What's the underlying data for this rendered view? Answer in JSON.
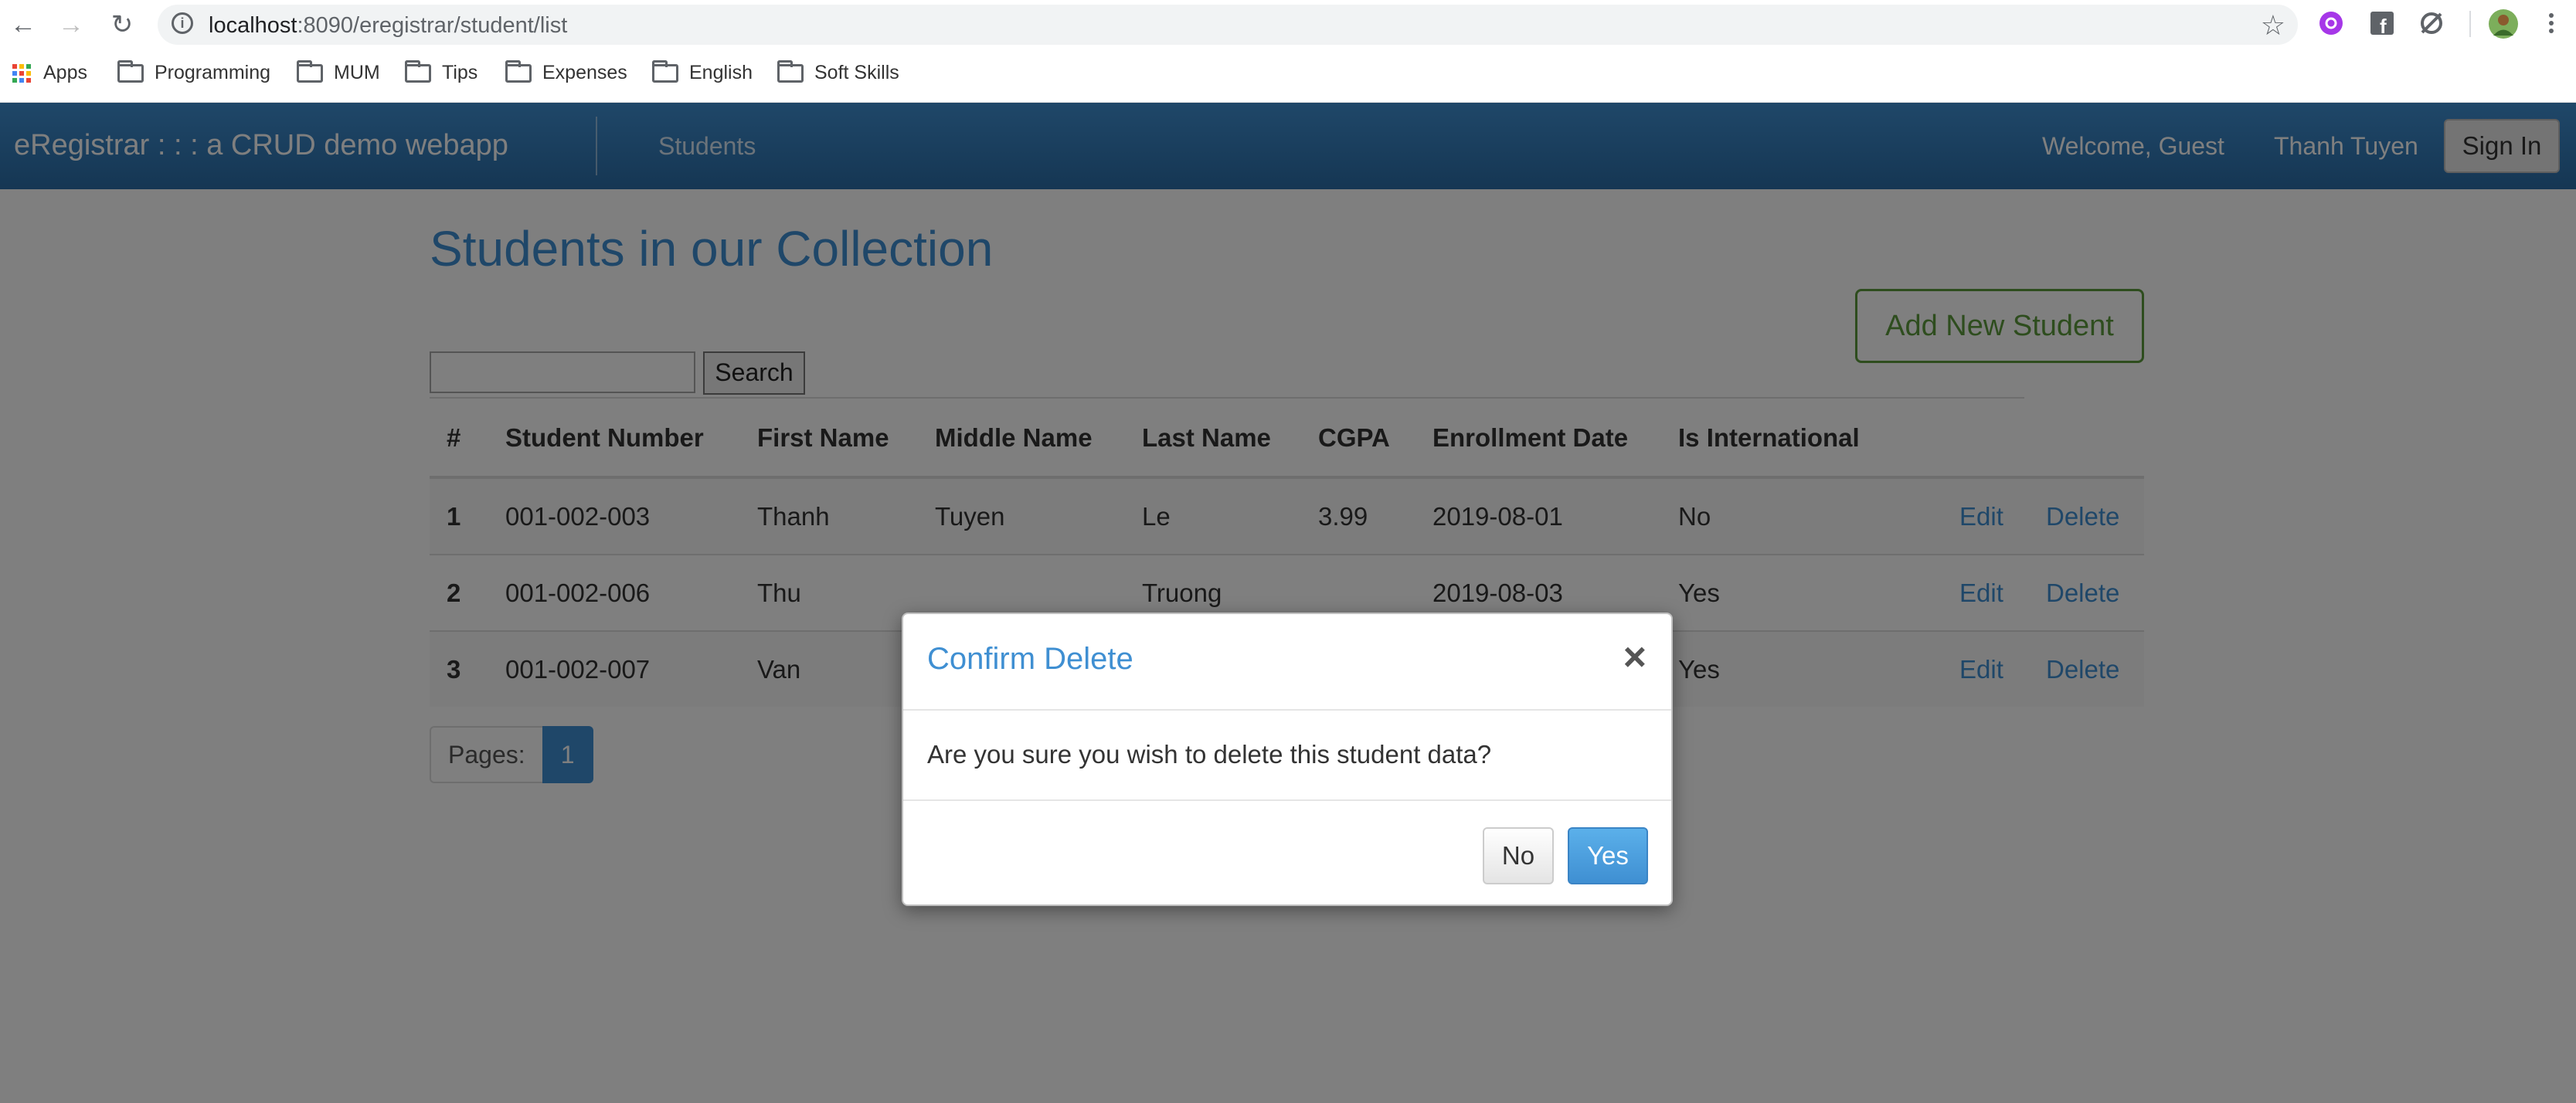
{
  "browser": {
    "url_host": "localhost",
    "url_path": ":8090/eregistrar/student/list",
    "bookmarks": [
      {
        "label": "Apps"
      },
      {
        "label": "Programming"
      },
      {
        "label": "MUM"
      },
      {
        "label": "Tips"
      },
      {
        "label": "Expenses"
      },
      {
        "label": "English"
      },
      {
        "label": "Soft Skills"
      }
    ]
  },
  "navbar": {
    "brand": "eRegistrar : : : a CRUD demo webapp",
    "students_link": "Students",
    "welcome": "Welcome, Guest",
    "user_name": "Thanh Tuyen",
    "sign_in": "Sign In"
  },
  "page": {
    "title": "Students in our Collection",
    "add_button": "Add New Student",
    "search_button": "Search",
    "pager_label": "Pages:",
    "current_page": "1"
  },
  "table": {
    "headers": [
      "#",
      "Student Number",
      "First Name",
      "Middle Name",
      "Last Name",
      "CGPA",
      "Enrollment Date",
      "Is International",
      "",
      ""
    ],
    "rows": [
      {
        "idx": "1",
        "number": "001-002-003",
        "first": "Thanh",
        "middle": "Tuyen",
        "last": "Le",
        "cgpa": "3.99",
        "date": "2019-08-01",
        "intl": "No",
        "edit": "Edit",
        "delete": "Delete"
      },
      {
        "idx": "2",
        "number": "001-002-006",
        "first": "Thu",
        "middle": "",
        "last": "Truong",
        "cgpa": "",
        "date": "2019-08-03",
        "intl": "Yes",
        "edit": "Edit",
        "delete": "Delete"
      },
      {
        "idx": "3",
        "number": "001-002-007",
        "first": "Van",
        "middle": "",
        "last": "",
        "cgpa": "",
        "date": "",
        "intl": "Yes",
        "edit": "Edit",
        "delete": "Delete"
      }
    ]
  },
  "modal": {
    "title": "Confirm Delete",
    "close": "×",
    "body": "Are you sure you wish to delete this student data?",
    "no": "No",
    "yes": "Yes"
  },
  "colors": {
    "primary": "#3f8fd2",
    "success": "#5d9a3c",
    "navbar_dark": "#2b6da7"
  },
  "icons": [
    "back-icon",
    "forward-icon",
    "reload-icon",
    "info-icon",
    "star-icon",
    "extension-icon",
    "facebook-icon",
    "sync-icon",
    "profile-avatar",
    "menu-icon",
    "apps-grid-icon",
    "folder-icon",
    "close-icon"
  ]
}
